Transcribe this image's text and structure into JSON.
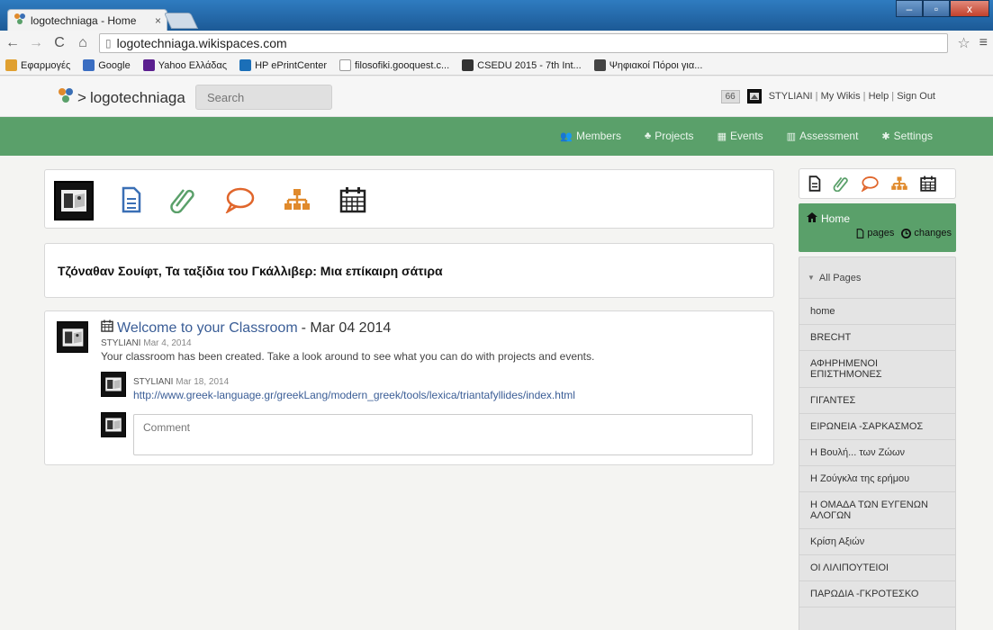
{
  "browser": {
    "tab_title": "logotechniaga - Home",
    "tab_close": "×",
    "url": "logotechniaga.wikispaces.com",
    "window_controls": {
      "minimize": "–",
      "maximize": "▫",
      "close": "x"
    },
    "bookmarks": [
      {
        "label": "Εφαρμογές",
        "icon": "apps-icon",
        "color": "#e0a030"
      },
      {
        "label": "Google",
        "icon": "google-icon",
        "color": "#3b6ec2"
      },
      {
        "label": "Yahoo Ελλάδας",
        "icon": "yahoo-icon",
        "color": "#5b1f8f"
      },
      {
        "label": "HP ePrintCenter",
        "icon": "hp-icon",
        "color": "#1b6fb8"
      },
      {
        "label": "filosofiki.gooquest.c...",
        "icon": "page-icon",
        "color": "#ffffff"
      },
      {
        "label": "CSEDU 2015 - 7th Int...",
        "icon": "csedu-icon",
        "color": "#333333"
      },
      {
        "label": "Ψηφιακοί Πόροι για...",
        "icon": "wp-icon",
        "color": "#444444"
      }
    ]
  },
  "site": {
    "brand": "logotechniaga",
    "brand_prefix": ">",
    "search_placeholder": "Search",
    "notification_count": "66",
    "user_links": [
      "STYLIANI",
      "My Wikis",
      "Help",
      "Sign Out"
    ],
    "nav": [
      {
        "label": "Members",
        "icon": "members-icon",
        "glyph": "👥"
      },
      {
        "label": "Projects",
        "icon": "projects-icon",
        "glyph": "♣"
      },
      {
        "label": "Events",
        "icon": "calendar-icon",
        "glyph": "▦"
      },
      {
        "label": "Assessment",
        "icon": "assessment-icon",
        "glyph": "▥"
      },
      {
        "label": "Settings",
        "icon": "settings-icon",
        "glyph": "✱"
      }
    ]
  },
  "colors": {
    "green": "#5aa06a",
    "icon_blue": "#3a6fb5",
    "icon_green": "#5aa06a",
    "icon_red": "#e0662c",
    "icon_orange": "#e08a2c",
    "link": "#3a5d96"
  },
  "main": {
    "page_title": "Τζόναθαν Σουίφτ, Τα ταξίδια του Γκάλλιβερ: Μια επίκαιρη σάτιρα",
    "post": {
      "title_link": "Welcome to your Classroom",
      "title_suffix": "- Mar 04 2014",
      "author": "STYLIANI",
      "date": "Mar 4, 2014",
      "body": "Your classroom has been created. Take a look around to see what you can do with projects and events.",
      "reply": {
        "author": "STYLIANI",
        "date": "Mar 18, 2014",
        "link": "http://www.greek-language.gr/greekLang/modern_greek/tools/lexica/triantafyllides/index.html"
      },
      "comment_placeholder": "Comment"
    }
  },
  "sidebar": {
    "home_label": "Home",
    "home_actions": {
      "pages": "pages",
      "changes": "changes"
    },
    "all_pages_label": "All Pages",
    "pages": [
      "home",
      "BRECHT",
      "ΑΦΗΡΗΜΕΝΟΙ ΕΠΙΣΤΗΜΟΝΕΣ",
      "ΓΙΓΑΝΤΕΣ",
      "ΕΙΡΩΝΕΙΑ -ΣΑΡΚΑΣΜΟΣ",
      "Η Βουλή... των Ζώων",
      "Η Ζούγκλα της ερήμου",
      "Η ΟΜΑΔΑ ΤΩΝ ΕΥΓΕΝΩΝ ΑΛΟΓΩΝ",
      "Κρίση Αξιών",
      "ΟΙ ΛΙΛΙΠΟΥΤΕΙΟΙ",
      "ΠΑΡΩΔΙΑ -ΓΚΡΟΤΕΣΚΟ"
    ]
  }
}
